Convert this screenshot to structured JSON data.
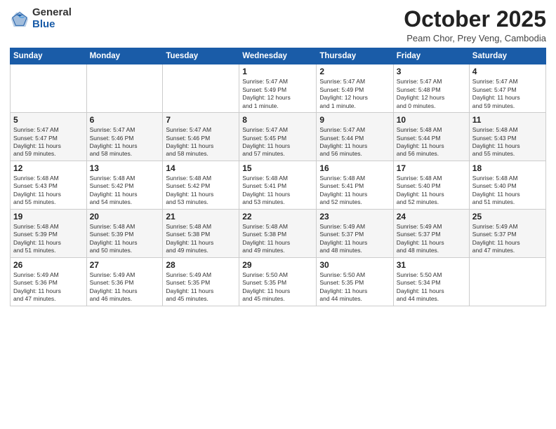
{
  "header": {
    "logo_general": "General",
    "logo_blue": "Blue",
    "month_title": "October 2025",
    "subtitle": "Peam Chor, Prey Veng, Cambodia"
  },
  "days_of_week": [
    "Sunday",
    "Monday",
    "Tuesday",
    "Wednesday",
    "Thursday",
    "Friday",
    "Saturday"
  ],
  "weeks": [
    [
      {
        "day": "",
        "info": ""
      },
      {
        "day": "",
        "info": ""
      },
      {
        "day": "",
        "info": ""
      },
      {
        "day": "1",
        "info": "Sunrise: 5:47 AM\nSunset: 5:49 PM\nDaylight: 12 hours\nand 1 minute."
      },
      {
        "day": "2",
        "info": "Sunrise: 5:47 AM\nSunset: 5:49 PM\nDaylight: 12 hours\nand 1 minute."
      },
      {
        "day": "3",
        "info": "Sunrise: 5:47 AM\nSunset: 5:48 PM\nDaylight: 12 hours\nand 0 minutes."
      },
      {
        "day": "4",
        "info": "Sunrise: 5:47 AM\nSunset: 5:47 PM\nDaylight: 11 hours\nand 59 minutes."
      }
    ],
    [
      {
        "day": "5",
        "info": "Sunrise: 5:47 AM\nSunset: 5:47 PM\nDaylight: 11 hours\nand 59 minutes."
      },
      {
        "day": "6",
        "info": "Sunrise: 5:47 AM\nSunset: 5:46 PM\nDaylight: 11 hours\nand 58 minutes."
      },
      {
        "day": "7",
        "info": "Sunrise: 5:47 AM\nSunset: 5:46 PM\nDaylight: 11 hours\nand 58 minutes."
      },
      {
        "day": "8",
        "info": "Sunrise: 5:47 AM\nSunset: 5:45 PM\nDaylight: 11 hours\nand 57 minutes."
      },
      {
        "day": "9",
        "info": "Sunrise: 5:47 AM\nSunset: 5:44 PM\nDaylight: 11 hours\nand 56 minutes."
      },
      {
        "day": "10",
        "info": "Sunrise: 5:48 AM\nSunset: 5:44 PM\nDaylight: 11 hours\nand 56 minutes."
      },
      {
        "day": "11",
        "info": "Sunrise: 5:48 AM\nSunset: 5:43 PM\nDaylight: 11 hours\nand 55 minutes."
      }
    ],
    [
      {
        "day": "12",
        "info": "Sunrise: 5:48 AM\nSunset: 5:43 PM\nDaylight: 11 hours\nand 55 minutes."
      },
      {
        "day": "13",
        "info": "Sunrise: 5:48 AM\nSunset: 5:42 PM\nDaylight: 11 hours\nand 54 minutes."
      },
      {
        "day": "14",
        "info": "Sunrise: 5:48 AM\nSunset: 5:42 PM\nDaylight: 11 hours\nand 53 minutes."
      },
      {
        "day": "15",
        "info": "Sunrise: 5:48 AM\nSunset: 5:41 PM\nDaylight: 11 hours\nand 53 minutes."
      },
      {
        "day": "16",
        "info": "Sunrise: 5:48 AM\nSunset: 5:41 PM\nDaylight: 11 hours\nand 52 minutes."
      },
      {
        "day": "17",
        "info": "Sunrise: 5:48 AM\nSunset: 5:40 PM\nDaylight: 11 hours\nand 52 minutes."
      },
      {
        "day": "18",
        "info": "Sunrise: 5:48 AM\nSunset: 5:40 PM\nDaylight: 11 hours\nand 51 minutes."
      }
    ],
    [
      {
        "day": "19",
        "info": "Sunrise: 5:48 AM\nSunset: 5:39 PM\nDaylight: 11 hours\nand 51 minutes."
      },
      {
        "day": "20",
        "info": "Sunrise: 5:48 AM\nSunset: 5:39 PM\nDaylight: 11 hours\nand 50 minutes."
      },
      {
        "day": "21",
        "info": "Sunrise: 5:48 AM\nSunset: 5:38 PM\nDaylight: 11 hours\nand 49 minutes."
      },
      {
        "day": "22",
        "info": "Sunrise: 5:48 AM\nSunset: 5:38 PM\nDaylight: 11 hours\nand 49 minutes."
      },
      {
        "day": "23",
        "info": "Sunrise: 5:49 AM\nSunset: 5:37 PM\nDaylight: 11 hours\nand 48 minutes."
      },
      {
        "day": "24",
        "info": "Sunrise: 5:49 AM\nSunset: 5:37 PM\nDaylight: 11 hours\nand 48 minutes."
      },
      {
        "day": "25",
        "info": "Sunrise: 5:49 AM\nSunset: 5:37 PM\nDaylight: 11 hours\nand 47 minutes."
      }
    ],
    [
      {
        "day": "26",
        "info": "Sunrise: 5:49 AM\nSunset: 5:36 PM\nDaylight: 11 hours\nand 47 minutes."
      },
      {
        "day": "27",
        "info": "Sunrise: 5:49 AM\nSunset: 5:36 PM\nDaylight: 11 hours\nand 46 minutes."
      },
      {
        "day": "28",
        "info": "Sunrise: 5:49 AM\nSunset: 5:35 PM\nDaylight: 11 hours\nand 45 minutes."
      },
      {
        "day": "29",
        "info": "Sunrise: 5:50 AM\nSunset: 5:35 PM\nDaylight: 11 hours\nand 45 minutes."
      },
      {
        "day": "30",
        "info": "Sunrise: 5:50 AM\nSunset: 5:35 PM\nDaylight: 11 hours\nand 44 minutes."
      },
      {
        "day": "31",
        "info": "Sunrise: 5:50 AM\nSunset: 5:34 PM\nDaylight: 11 hours\nand 44 minutes."
      },
      {
        "day": "",
        "info": ""
      }
    ]
  ]
}
